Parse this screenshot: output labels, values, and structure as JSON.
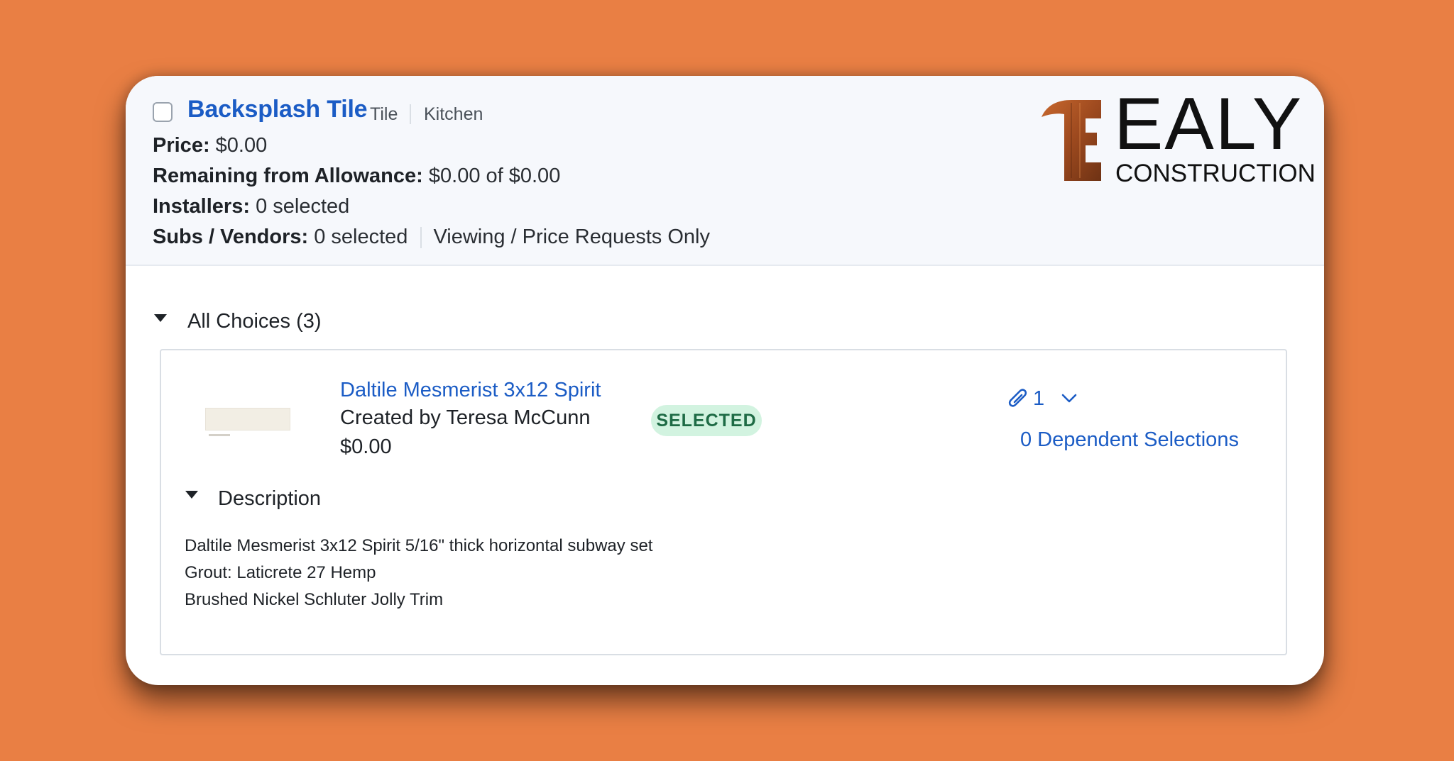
{
  "header": {
    "title": "Backsplash Tile",
    "category": "Tile",
    "location": "Kitchen",
    "price_label": "Price:",
    "price_value": "$0.00",
    "allowance_label": "Remaining from Allowance:",
    "allowance_value": "$0.00 of $0.00",
    "installers_label": "Installers:",
    "installers_value": "0 selected",
    "subs_label": "Subs / Vendors:",
    "subs_value": "0 selected",
    "viewing_text": "Viewing / Price Requests Only"
  },
  "logo": {
    "letter": "E",
    "name": "EALY",
    "tagline": "CONSTRUCTION"
  },
  "choices_section": {
    "label": "All Choices (3)"
  },
  "choice": {
    "name": "Daltile Mesmerist 3x12 Spirit",
    "created_by": "Created by Teresa McCunn",
    "price": "$0.00",
    "status": "SELECTED",
    "attachment_count": "1",
    "dependent": "0 Dependent Selections",
    "description_label": "Description",
    "description_lines": [
      "Daltile Mesmerist 3x12 Spirit 5/16\" thick horizontal subway set",
      "Grout: Laticrete 27 Hemp",
      "Brushed Nickel Schluter Jolly Trim"
    ]
  },
  "colors": {
    "background": "#E97F44",
    "link": "#1B5CC5",
    "badge_bg": "#D2F3E0",
    "badge_text": "#1E6B45"
  }
}
